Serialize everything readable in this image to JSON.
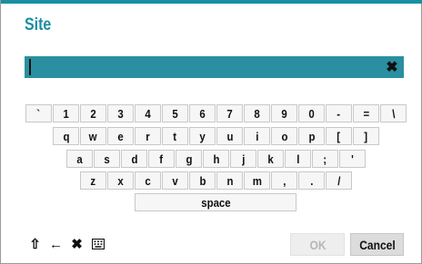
{
  "dialog": {
    "title": "Site"
  },
  "input": {
    "value": "",
    "clear_icon": "✖"
  },
  "keyboard": {
    "row1": [
      "`",
      "1",
      "2",
      "3",
      "4",
      "5",
      "6",
      "7",
      "8",
      "9",
      "0",
      "-",
      "=",
      "\\"
    ],
    "row2": [
      "q",
      "w",
      "e",
      "r",
      "t",
      "y",
      "u",
      "i",
      "o",
      "p",
      "[",
      "]"
    ],
    "row3": [
      "a",
      "s",
      "d",
      "f",
      "g",
      "h",
      "j",
      "k",
      "l",
      ";",
      "'"
    ],
    "row4": [
      "z",
      "x",
      "c",
      "v",
      "b",
      "n",
      "m",
      ",",
      ".",
      "/"
    ],
    "space_label": "space"
  },
  "toolbar": {
    "shift_icon": "⇧",
    "backspace_icon": "←",
    "clear_icon": "✖",
    "keyboard_icon": "keyboard"
  },
  "buttons": {
    "ok_label": "OK",
    "cancel_label": "Cancel"
  },
  "colors": {
    "accent": "#1a8ea2",
    "input_bg": "#2a8fa0"
  }
}
